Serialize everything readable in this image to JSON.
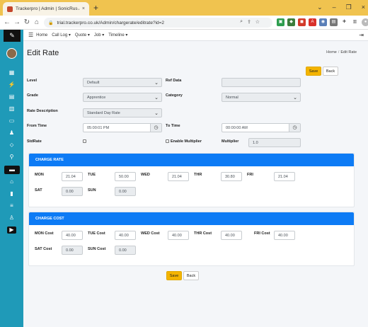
{
  "browser": {
    "tab_title": "Trackerpro | Admin | SonicRus Ai",
    "tab_close": "×",
    "new_tab": "+",
    "url": "trial.trackerpro.co.uk/Admin/chargerate/editrate?id=2",
    "window_controls": [
      "⌄",
      "–",
      "❐",
      "×"
    ]
  },
  "topnav": {
    "items": [
      "Home",
      "Call Log ▾",
      "Quote ▾",
      "Job ▾",
      "Timeline ▾"
    ]
  },
  "page": {
    "title": "Edit Rate",
    "breadcrumb": [
      "Home",
      "/",
      "Edit Rate"
    ],
    "save_label": "Save",
    "back_label": "Back"
  },
  "form": {
    "level_label": "Level",
    "level_value": "Default",
    "ref_data_label": "Ref Data",
    "ref_data_value": "",
    "grade_label": "Grade",
    "grade_value": "Apprentice",
    "category_label": "Category",
    "category_value": "Normal",
    "rate_desc_label": "Rate Description",
    "rate_desc_value": "Standard Day Rate",
    "from_time_label": "From Time",
    "from_time_value": "05:00:01 PM",
    "to_time_label": "To Time",
    "to_time_value": "00:00:00 AM",
    "std_rate_label": "StdRate",
    "std_rate_checked": false,
    "enable_multiplier_label": "Enable Multiplier",
    "enable_multiplier_checked": false,
    "multiplier_label": "Multiplier",
    "multiplier_value": "1.0"
  },
  "charge_rate": {
    "title": "CHARGE RATE",
    "days": [
      {
        "label": "MON",
        "value": "21.04"
      },
      {
        "label": "TUE",
        "value": "50.00"
      },
      {
        "label": "WED",
        "value": "21.04"
      },
      {
        "label": "THR",
        "value": "30.80"
      },
      {
        "label": "FRI",
        "value": "21.04"
      },
      {
        "label": "SAT",
        "value": "0.00"
      },
      {
        "label": "SUN",
        "value": "0.00"
      }
    ]
  },
  "charge_cost": {
    "title": "CHARGE COST",
    "days": [
      {
        "label": "MON Cost",
        "value": "40.00"
      },
      {
        "label": "TUE Cost",
        "value": "40.00"
      },
      {
        "label": "WED Cost",
        "value": "40.00"
      },
      {
        "label": "THR Cost",
        "value": "40.00"
      },
      {
        "label": "FRI Cost",
        "value": "40.00"
      },
      {
        "label": "SAT Cost",
        "value": "0.00"
      },
      {
        "label": "SUN Cost",
        "value": "0.00"
      }
    ]
  },
  "colors": {
    "accent": "#0d7bf5",
    "sidebar": "#1f9ab8",
    "save_button": "#f4b400",
    "tab_strip": "#f0c34f"
  }
}
